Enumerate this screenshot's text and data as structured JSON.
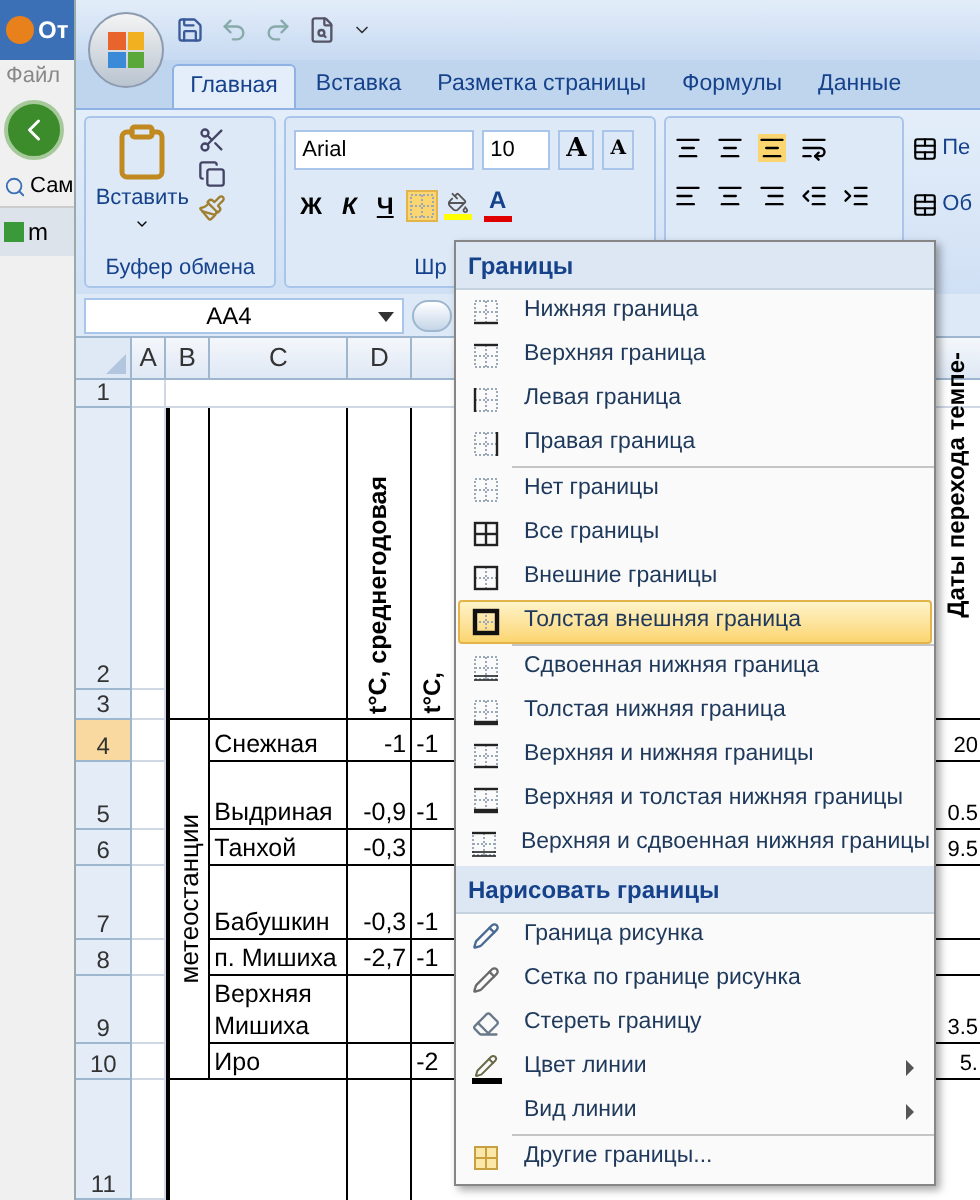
{
  "browser": {
    "title": "От",
    "menu": "Файл",
    "bookmark": "Сам",
    "tab": "m"
  },
  "tabs": [
    {
      "label": "Главная",
      "selected": true
    },
    {
      "label": "Вставка",
      "selected": false
    },
    {
      "label": "Разметка страницы",
      "selected": false
    },
    {
      "label": "Формулы",
      "selected": false
    },
    {
      "label": "Данные",
      "selected": false
    }
  ],
  "ribbon": {
    "paste": "Вставить",
    "clipboard_group": "Буфер обмена",
    "font_name": "Arial",
    "font_size": "10",
    "grow_font": "A",
    "shrink_font": "A",
    "bold": "Ж",
    "italic": "К",
    "underline": "Ч",
    "font_color": "A",
    "font_group": "Шр",
    "right_buttons": [
      "Пе",
      "Об"
    ]
  },
  "name_box": "AA4",
  "columns": [
    "A",
    "B",
    "C",
    "D"
  ],
  "headers": {
    "d": "t°C, среднегодовая",
    "e": "t°C,",
    "f": "Даты перехода темпе-",
    "group": "метеостанции"
  },
  "rows": [
    {
      "number": "1",
      "selected": false
    },
    {
      "number": "2",
      "selected": false
    },
    {
      "number": "3",
      "selected": false
    },
    {
      "number": "4",
      "selected": true,
      "c": "Снежная",
      "d": "-1",
      "e": "-1",
      "f": "20"
    },
    {
      "number": "5",
      "selected": false,
      "c": "Выдриная",
      "d": "-0,9",
      "e": "-1",
      "f": "0.5"
    },
    {
      "number": "6",
      "selected": false,
      "c": "Танхой",
      "d": "-0,3",
      "f": "9.5"
    },
    {
      "number": "7",
      "selected": false,
      "c": "Бабушкин",
      "d": "-0,3",
      "e": "-1"
    },
    {
      "number": "8",
      "selected": false,
      "c": "п. Мишиха",
      "d": "-2,7",
      "e": "-1"
    },
    {
      "number": "9",
      "selected": false,
      "c": "Верхняя Мишиха",
      "f": "3.5"
    },
    {
      "number": "10",
      "selected": false,
      "c": "Иро",
      "e": "-2",
      "f": "5."
    },
    {
      "number": "11",
      "selected": false
    }
  ],
  "menu": {
    "sections": [
      {
        "title": "Границы",
        "groups": [
          [
            {
              "label": "Нижняя граница",
              "kind": "bottom",
              "selected": false,
              "submenu": false
            },
            {
              "label": "Верхняя граница",
              "kind": "top",
              "selected": false,
              "submenu": false
            },
            {
              "label": "Левая граница",
              "kind": "left",
              "selected": false,
              "submenu": false
            },
            {
              "label": "Правая граница",
              "kind": "right",
              "selected": false,
              "submenu": false
            }
          ],
          [
            {
              "label": "Нет границы",
              "kind": "none",
              "selected": false,
              "submenu": false
            },
            {
              "label": "Все границы",
              "kind": "all",
              "selected": false,
              "submenu": false
            },
            {
              "label": "Внешние границы",
              "kind": "outside",
              "selected": false,
              "submenu": false
            },
            {
              "label": "Толстая внешняя граница",
              "kind": "thickoutside",
              "selected": true,
              "submenu": false
            }
          ],
          [
            {
              "label": "Сдвоенная нижняя граница",
              "kind": "doublebottom",
              "selected": false,
              "submenu": false
            },
            {
              "label": "Толстая нижняя граница",
              "kind": "thickbottom",
              "selected": false,
              "submenu": false
            },
            {
              "label": "Верхняя и нижняя границы",
              "kind": "topbottom",
              "selected": false,
              "submenu": false
            },
            {
              "label": "Верхняя и толстая нижняя границы",
              "kind": "topthickbottom",
              "selected": false,
              "submenu": false
            },
            {
              "label": "Верхняя и сдвоенная нижняя границы",
              "kind": "topdoublebottom",
              "selected": false,
              "submenu": false
            }
          ]
        ]
      },
      {
        "title": "Нарисовать границы",
        "groups": [
          [
            {
              "label": "Граница рисунка",
              "kind": "draw",
              "selected": false,
              "submenu": false
            },
            {
              "label": "Сетка по границе рисунка",
              "kind": "drawgrid",
              "selected": false,
              "submenu": false
            },
            {
              "label": "Стереть границу",
              "kind": "erase",
              "selected": false,
              "submenu": false
            },
            {
              "label": "Цвет линии",
              "kind": "linecolor",
              "selected": false,
              "submenu": true
            },
            {
              "label": "Вид линии",
              "kind": "linestyle",
              "selected": false,
              "submenu": true
            }
          ],
          [
            {
              "label": "Другие границы...",
              "kind": "more",
              "selected": false,
              "submenu": false
            }
          ]
        ]
      }
    ]
  }
}
